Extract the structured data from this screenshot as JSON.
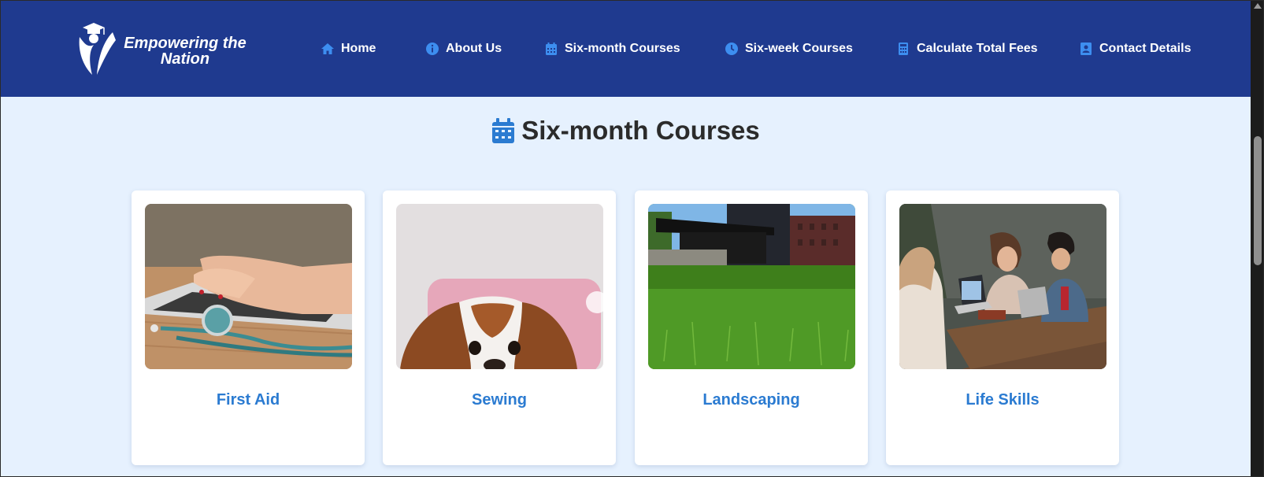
{
  "brand": {
    "line1": "Empowering the",
    "line2": "Nation"
  },
  "nav": [
    {
      "label": "Home",
      "icon": "home-icon"
    },
    {
      "label": "About Us",
      "icon": "info-icon"
    },
    {
      "label": "Six-month Courses",
      "icon": "calendar-icon"
    },
    {
      "label": "Six-week Courses",
      "icon": "clock-icon"
    },
    {
      "label": "Calculate Total Fees",
      "icon": "calculator-icon"
    },
    {
      "label": "Contact Details",
      "icon": "contact-icon"
    }
  ],
  "section": {
    "title": "Six-month Courses",
    "icon": "calendar-icon"
  },
  "courses": [
    {
      "name": "First Aid",
      "image": "laptop-stethoscope-photo"
    },
    {
      "name": "Sewing",
      "image": "puppy-pillow-photo"
    },
    {
      "name": "Landscaping",
      "image": "lawn-buildings-photo"
    },
    {
      "name": "Life Skills",
      "image": "group-laptops-photo"
    }
  ],
  "colors": {
    "header": "#1f3a8f",
    "page_bg": "#e6f1fe",
    "accent": "#2b7bd1",
    "title": "#2b2b2b"
  }
}
